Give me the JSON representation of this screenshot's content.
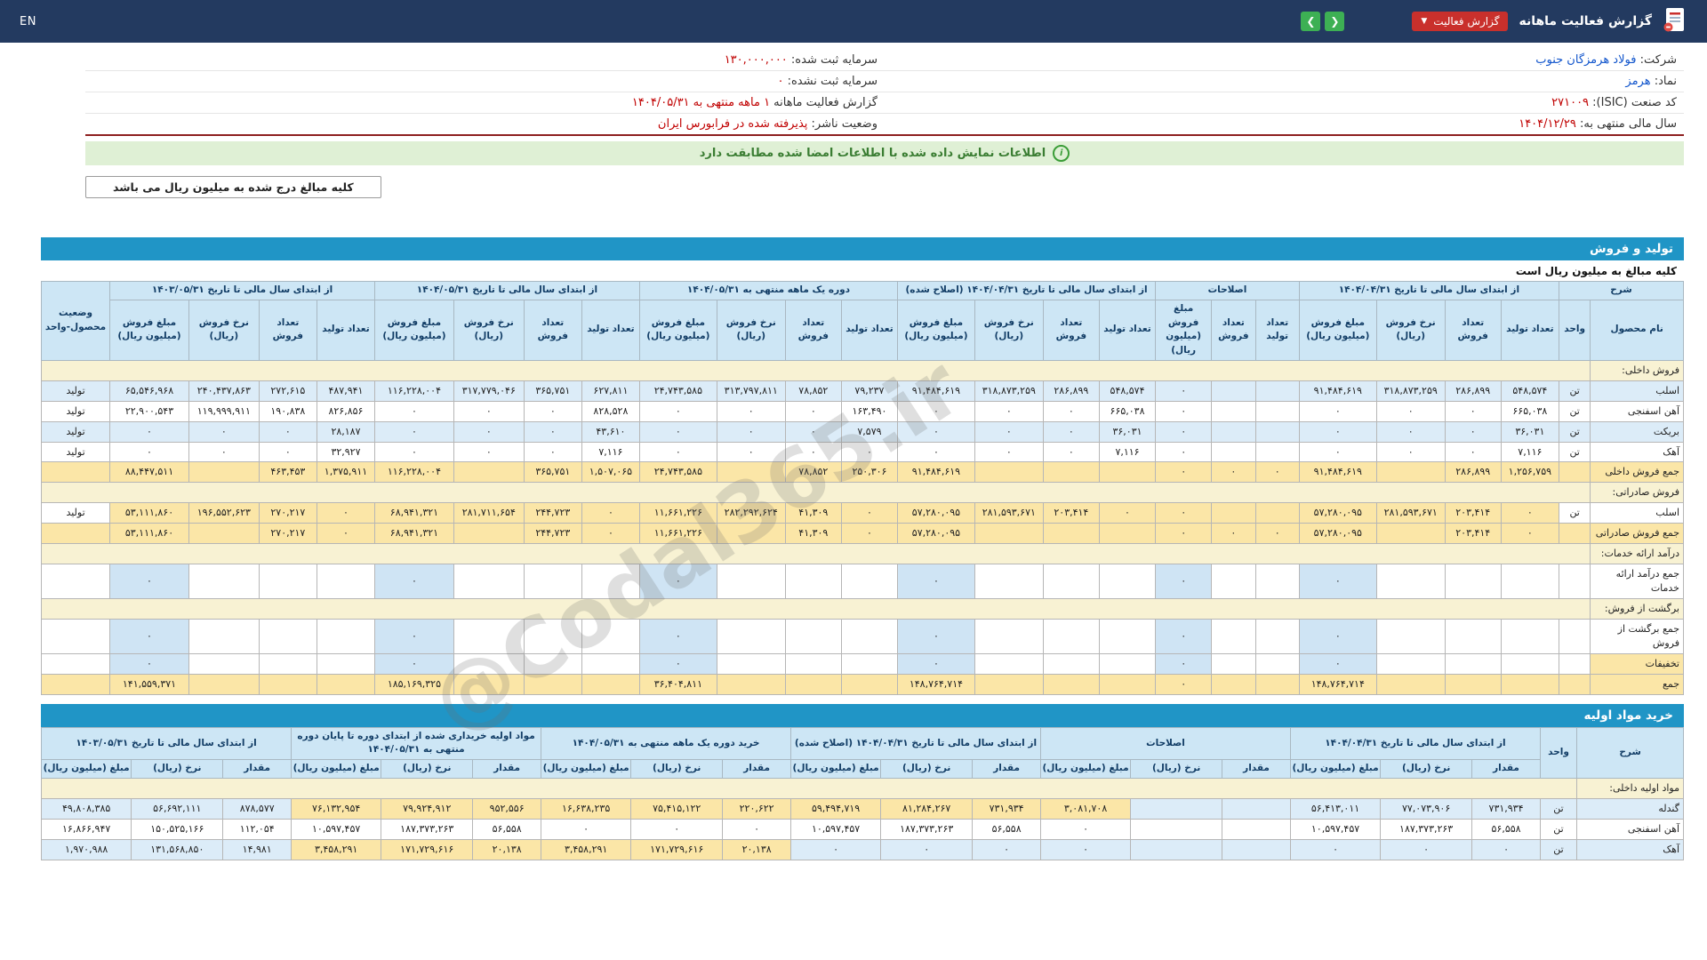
{
  "navbar": {
    "title": "گزارش فعالیت ماهانه",
    "report_type_badge": "گزارش فعالیت",
    "lang": "EN"
  },
  "icons": {
    "prev": "❮",
    "next": "❯",
    "dropdown": "▼",
    "info": "i"
  },
  "company_info": {
    "rows": [
      {
        "r_label": "شرکت:",
        "r_value": "فولاد هرمزگان جنوب",
        "r_link": true,
        "l_label": "سرمایه ثبت شده:",
        "l_value": "۱۳۰,۰۰۰,۰۰۰"
      },
      {
        "r_label": "نماد:",
        "r_value": "هرمز",
        "r_link": true,
        "l_label": "سرمایه ثبت نشده:",
        "l_value": "۰"
      },
      {
        "r_label": "کد صنعت (ISIC):",
        "r_value": "۲۷۱۰۰۹",
        "r_link": false,
        "l_label": "گزارش فعالیت ماهانه",
        "l_value": "۱ ماهه منتهی به ۱۴۰۴/۰۵/۳۱"
      },
      {
        "r_label": "سال مالی منتهی به:",
        "r_value": "۱۴۰۴/۱۲/۲۹",
        "r_link": false,
        "l_label": "وضعیت ناشر:",
        "l_value": "پذیرفته شده در فرابورس ایران"
      }
    ]
  },
  "signature_banner": "اطلاعات نمایش داده شده با اطلاعات امضا شده مطابقت دارد",
  "amounts_note": "کلیه مبالغ درج شده به میلیون ریال می باشد",
  "watermark": "@Codal365.ir",
  "sales_section": {
    "title": "تولید و فروش",
    "note": "کلیه مبالغ به میلیون ریال است",
    "table": {
      "col_widths": [
        "5.3%",
        "1.8%",
        "3.3%",
        "3.2%",
        "3.9%",
        "4.4%",
        "2.5%",
        "2.5%",
        "3.2%",
        "3.2%",
        "3.2%",
        "3.9%",
        "4.4%",
        "3.2%",
        "3.2%",
        "3.9%",
        "4.4%",
        "3.3%",
        "3.3%",
        "4.0%",
        "4.5%",
        "3.3%",
        "3.3%",
        "4.0%",
        "4.5%",
        "3.9%"
      ],
      "header_groups": [
        {
          "title": "شرح",
          "cols": [
            "نام محصول",
            "واحد"
          ]
        },
        {
          "title": "از ابتدای سال مالی تا تاریخ ۱۴۰۴/۰۴/۳۱",
          "cols": [
            "تعداد تولید",
            "تعداد فروش",
            "نرخ فروش (ریال)",
            "مبلغ فروش (میلیون ریال)"
          ]
        },
        {
          "title": "اصلاحات",
          "cols": [
            "تعداد تولید",
            "تعداد فروش",
            "مبلغ فروش (میلیون ریال)"
          ]
        },
        {
          "title": "از ابتدای سال مالی تا تاریخ ۱۴۰۴/۰۴/۳۱ (اصلاح شده)",
          "cols": [
            "تعداد تولید",
            "تعداد فروش",
            "نرخ فروش (ریال)",
            "مبلغ فروش (میلیون ریال)"
          ]
        },
        {
          "title": "دوره یک ماهه منتهی به ۱۴۰۴/۰۵/۳۱",
          "cols": [
            "تعداد تولید",
            "تعداد فروش",
            "نرخ فروش (ریال)",
            "مبلغ فروش (میلیون ریال)"
          ]
        },
        {
          "title": "از ابتدای سال مالی تا تاریخ ۱۴۰۴/۰۵/۳۱",
          "cols": [
            "تعداد تولید",
            "تعداد فروش",
            "نرخ فروش (ریال)",
            "مبلغ فروش (میلیون ریال)"
          ]
        },
        {
          "title": "از ابتدای سال مالی تا تاریخ ۱۴۰۳/۰۵/۳۱",
          "cols": [
            "تعداد تولید",
            "تعداد فروش",
            "نرخ فروش (ریال)",
            "مبلغ فروش (میلیون ریال)"
          ]
        },
        {
          "title": "وضعیت محصول-واحد",
          "cols": []
        }
      ],
      "rows": [
        {
          "type": "section",
          "label": "فروش داخلی:"
        },
        {
          "type": "data",
          "bg": "blue",
          "cells": [
            "اسلب",
            "تن",
            "۵۴۸,۵۷۴",
            "۲۸۶,۸۹۹",
            "۳۱۸,۸۷۳,۲۵۹",
            "۹۱,۴۸۴,۶۱۹",
            "",
            "",
            "۰",
            "۵۴۸,۵۷۴",
            "۲۸۶,۸۹۹",
            "۳۱۸,۸۷۳,۲۵۹",
            "۹۱,۴۸۴,۶۱۹",
            "۷۹,۲۳۷",
            "۷۸,۸۵۲",
            "۳۱۳,۷۹۷,۸۱۱",
            "۲۴,۷۴۳,۵۸۵",
            "۶۲۷,۸۱۱",
            "۳۶۵,۷۵۱",
            "۳۱۷,۷۷۹,۰۴۶",
            "۱۱۶,۲۲۸,۰۰۴",
            "۴۸۷,۹۴۱",
            "۲۷۲,۶۱۵",
            "۲۴۰,۴۳۷,۸۶۳",
            "۶۵,۵۴۶,۹۶۸",
            "تولید"
          ]
        },
        {
          "type": "data",
          "bg": "white",
          "cells": [
            "آهن اسفنجی",
            "تن",
            "۶۶۵,۰۳۸",
            "۰",
            "۰",
            "۰",
            "",
            "",
            "۰",
            "۶۶۵,۰۳۸",
            "۰",
            "۰",
            "۰",
            "۱۶۳,۴۹۰",
            "۰",
            "۰",
            "۰",
            "۸۲۸,۵۲۸",
            "۰",
            "۰",
            "۰",
            "۸۲۶,۸۵۶",
            "۱۹۰,۸۳۸",
            "۱۱۹,۹۹۹,۹۱۱",
            "۲۲,۹۰۰,۵۴۳",
            "تولید"
          ]
        },
        {
          "type": "data",
          "bg": "blue",
          "cells": [
            "بریکت",
            "تن",
            "۳۶,۰۳۱",
            "۰",
            "۰",
            "۰",
            "",
            "",
            "۰",
            "۳۶,۰۳۱",
            "۰",
            "۰",
            "۰",
            "۷,۵۷۹",
            "۰",
            "۰",
            "۰",
            "۴۳,۶۱۰",
            "۰",
            "۰",
            "۰",
            "۲۸,۱۸۷",
            "۰",
            "۰",
            "۰",
            "تولید"
          ]
        },
        {
          "type": "data",
          "bg": "white",
          "cells": [
            "آهک",
            "تن",
            "۷,۱۱۶",
            "۰",
            "۰",
            "۰",
            "",
            "",
            "۰",
            "۷,۱۱۶",
            "۰",
            "۰",
            "۰",
            "۰",
            "۰",
            "۰",
            "۰",
            "۷,۱۱۶",
            "۰",
            "۰",
            "۰",
            "۳۲,۹۲۷",
            "۰",
            "۰",
            "۰",
            "تولید"
          ]
        },
        {
          "type": "data",
          "bg": "wheat",
          "cells": [
            "جمع فروش داخلی",
            "",
            "۱,۲۵۶,۷۵۹",
            "۲۸۶,۸۹۹",
            "",
            "۹۱,۴۸۴,۶۱۹",
            "۰",
            "۰",
            "۰",
            "",
            "",
            "",
            "۹۱,۴۸۴,۶۱۹",
            "۲۵۰,۳۰۶",
            "۷۸,۸۵۲",
            "",
            "۲۴,۷۴۳,۵۸۵",
            "۱,۵۰۷,۰۶۵",
            "۳۶۵,۷۵۱",
            "",
            "۱۱۶,۲۲۸,۰۰۴",
            "۱,۳۷۵,۹۱۱",
            "۴۶۳,۴۵۳",
            "",
            "۸۸,۴۴۷,۵۱۱",
            ""
          ]
        },
        {
          "type": "section",
          "label": "فروش صادراتی:"
        },
        {
          "type": "data",
          "bg": "white",
          "yellow": [
            2,
            3,
            4,
            5,
            6,
            7,
            8,
            9,
            10,
            11,
            12,
            13,
            14,
            15,
            16,
            17,
            18,
            19,
            20,
            21,
            22,
            23,
            24
          ],
          "cells": [
            "اسلب",
            "تن",
            "۰",
            "۲۰۳,۴۱۴",
            "۲۸۱,۵۹۳,۶۷۱",
            "۵۷,۲۸۰,۰۹۵",
            "",
            "",
            "۰",
            "۰",
            "۲۰۳,۴۱۴",
            "۲۸۱,۵۹۳,۶۷۱",
            "۵۷,۲۸۰,۰۹۵",
            "۰",
            "۴۱,۳۰۹",
            "۲۸۲,۲۹۲,۶۲۴",
            "۱۱,۶۶۱,۲۲۶",
            "۰",
            "۲۴۴,۷۲۳",
            "۲۸۱,۷۱۱,۶۵۴",
            "۶۸,۹۴۱,۳۲۱",
            "۰",
            "۲۷۰,۲۱۷",
            "۱۹۶,۵۵۲,۶۲۳",
            "۵۳,۱۱۱,۸۶۰",
            "تولید"
          ]
        },
        {
          "type": "data",
          "bg": "wheat",
          "cells": [
            "جمع فروش صادراتی",
            "",
            "۰",
            "۲۰۳,۴۱۴",
            "",
            "۵۷,۲۸۰,۰۹۵",
            "۰",
            "۰",
            "۰",
            "",
            "",
            "",
            "۵۷,۲۸۰,۰۹۵",
            "۰",
            "۴۱,۳۰۹",
            "",
            "۱۱,۶۶۱,۲۲۶",
            "۰",
            "۲۴۴,۷۲۳",
            "",
            "۶۸,۹۴۱,۳۲۱",
            "۰",
            "۲۷۰,۲۱۷",
            "",
            "۵۳,۱۱۱,۸۶۰",
            ""
          ]
        },
        {
          "type": "section",
          "label": "درآمد ارائه خدمات:"
        },
        {
          "type": "data",
          "bg": "white",
          "blue": [
            5,
            8,
            12,
            16,
            20,
            24
          ],
          "cells": [
            "جمع درآمد ارائه خدمات",
            "",
            "",
            "",
            "",
            "۰",
            "",
            "",
            "۰",
            "",
            "",
            "",
            "۰",
            "",
            "",
            "",
            "۰",
            "",
            "",
            "",
            "۰",
            "",
            "",
            "",
            "۰",
            ""
          ]
        },
        {
          "type": "section",
          "label": "برگشت از فروش:"
        },
        {
          "type": "data",
          "bg": "white",
          "blue": [
            5,
            8,
            12,
            16,
            20,
            24
          ],
          "cells": [
            "جمع برگشت از فروش",
            "",
            "",
            "",
            "",
            "۰",
            "",
            "",
            "۰",
            "",
            "",
            "",
            "۰",
            "",
            "",
            "",
            "۰",
            "",
            "",
            "",
            "۰",
            "",
            "",
            "",
            "۰",
            ""
          ]
        },
        {
          "type": "data",
          "bg": "white",
          "yellow": [
            0
          ],
          "blue": [
            5,
            8,
            12,
            16,
            20,
            24
          ],
          "cells": [
            "تخفیفات",
            "",
            "",
            "",
            "",
            "۰",
            "",
            "",
            "۰",
            "",
            "",
            "",
            "۰",
            "",
            "",
            "",
            "۰",
            "",
            "",
            "",
            "۰",
            "",
            "",
            "",
            "۰",
            ""
          ]
        },
        {
          "type": "data",
          "bg": "wheat",
          "cells": [
            "جمع",
            "",
            "",
            "",
            "",
            "۱۴۸,۷۶۴,۷۱۴",
            "",
            "",
            "۰",
            "",
            "",
            "",
            "۱۴۸,۷۶۴,۷۱۴",
            "",
            "",
            "",
            "۳۶,۴۰۴,۸۱۱",
            "",
            "",
            "",
            "۱۸۵,۱۶۹,۳۲۵",
            "",
            "",
            "",
            "۱۴۱,۵۵۹,۳۷۱",
            ""
          ]
        }
      ]
    }
  },
  "purchases_section": {
    "title": "خرید مواد اولیه",
    "table": {
      "col_widths": [
        "6.4%",
        "2.2%",
        "4.1%",
        "5.5%",
        "5.4%",
        "4.1%",
        "5.5%",
        "5.4%",
        "4.1%",
        "5.5%",
        "5.4%",
        "4.1%",
        "5.5%",
        "5.4%",
        "4.1%",
        "5.5%",
        "5.4%",
        "4.1%",
        "5.5%",
        "5.4%"
      ],
      "header_groups": [
        {
          "title": "شرح",
          "cols": []
        },
        {
          "title": "واحد",
          "cols": []
        },
        {
          "title": "از ابتدای سال مالی تا تاریخ ۱۴۰۴/۰۴/۳۱",
          "cols": [
            "مقدار",
            "نرخ (ریال)",
            "مبلغ (میلیون ریال)"
          ]
        },
        {
          "title": "اصلاحات",
          "cols": [
            "مقدار",
            "نرخ (ریال)",
            "مبلغ (میلیون ریال)"
          ]
        },
        {
          "title": "از ابتدای سال مالی تا تاریخ ۱۴۰۴/۰۴/۳۱ (اصلاح شده)",
          "cols": [
            "مقدار",
            "نرخ (ریال)",
            "مبلغ (میلیون ریال)"
          ]
        },
        {
          "title": "خرید دوره یک ماهه منتهی به ۱۴۰۴/۰۵/۳۱",
          "cols": [
            "مقدار",
            "نرخ (ریال)",
            "مبلغ (میلیون ریال)"
          ]
        },
        {
          "title": "مواد اولیه خریداری شده از ابتدای دوره تا پایان دوره منتهی به ۱۴۰۴/۰۵/۳۱",
          "cols": [
            "مقدار",
            "نرخ (ریال)",
            "مبلغ (میلیون ریال)"
          ]
        },
        {
          "title": "از ابتدای سال مالی تا تاریخ ۱۴۰۳/۰۵/۳۱",
          "cols": [
            "مقدار",
            "نرخ (ریال)",
            "مبلغ (میلیون ریال)"
          ]
        }
      ],
      "rows": [
        {
          "type": "section",
          "label": "مواد اولیه داخلی:"
        },
        {
          "type": "data",
          "bg": "blue",
          "yellow": [
            7,
            8,
            9,
            10,
            11,
            12,
            13,
            14,
            15,
            16
          ],
          "cells": [
            "گندله",
            "تن",
            "۷۳۱,۹۳۴",
            "۷۷,۰۷۳,۹۰۶",
            "۵۶,۴۱۳,۰۱۱",
            "",
            "",
            "۳,۰۸۱,۷۰۸",
            "۷۳۱,۹۳۴",
            "۸۱,۲۸۴,۲۶۷",
            "۵۹,۴۹۴,۷۱۹",
            "۲۲۰,۶۲۲",
            "۷۵,۴۱۵,۱۲۲",
            "۱۶,۶۳۸,۲۳۵",
            "۹۵۲,۵۵۶",
            "۷۹,۹۲۴,۹۱۲",
            "۷۶,۱۳۲,۹۵۴",
            "۸۷۸,۵۷۷",
            "۵۶,۶۹۲,۱۱۱",
            "۴۹,۸۰۸,۳۸۵"
          ]
        },
        {
          "type": "data",
          "bg": "white",
          "cells": [
            "آهن اسفنجی",
            "تن",
            "۵۶,۵۵۸",
            "۱۸۷,۳۷۳,۲۶۳",
            "۱۰,۵۹۷,۴۵۷",
            "",
            "",
            "۰",
            "۵۶,۵۵۸",
            "۱۸۷,۳۷۳,۲۶۳",
            "۱۰,۵۹۷,۴۵۷",
            "۰",
            "۰",
            "۰",
            "۵۶,۵۵۸",
            "۱۸۷,۳۷۳,۲۶۳",
            "۱۰,۵۹۷,۴۵۷",
            "۱۱۲,۰۵۴",
            "۱۵۰,۵۲۵,۱۶۶",
            "۱۶,۸۶۶,۹۴۷"
          ]
        },
        {
          "type": "data",
          "bg": "blue",
          "yellow": [
            11,
            12,
            13,
            14,
            15,
            16
          ],
          "cells": [
            "آهک",
            "تن",
            "۰",
            "۰",
            "۰",
            "",
            "",
            "۰",
            "۰",
            "۰",
            "۰",
            "۲۰,۱۳۸",
            "۱۷۱,۷۲۹,۶۱۶",
            "۳,۴۵۸,۲۹۱",
            "۲۰,۱۳۸",
            "۱۷۱,۷۲۹,۶۱۶",
            "۳,۴۵۸,۲۹۱",
            "۱۴,۹۸۱",
            "۱۳۱,۵۶۸,۸۵۰",
            "۱,۹۷۰,۹۸۸"
          ]
        }
      ]
    }
  }
}
